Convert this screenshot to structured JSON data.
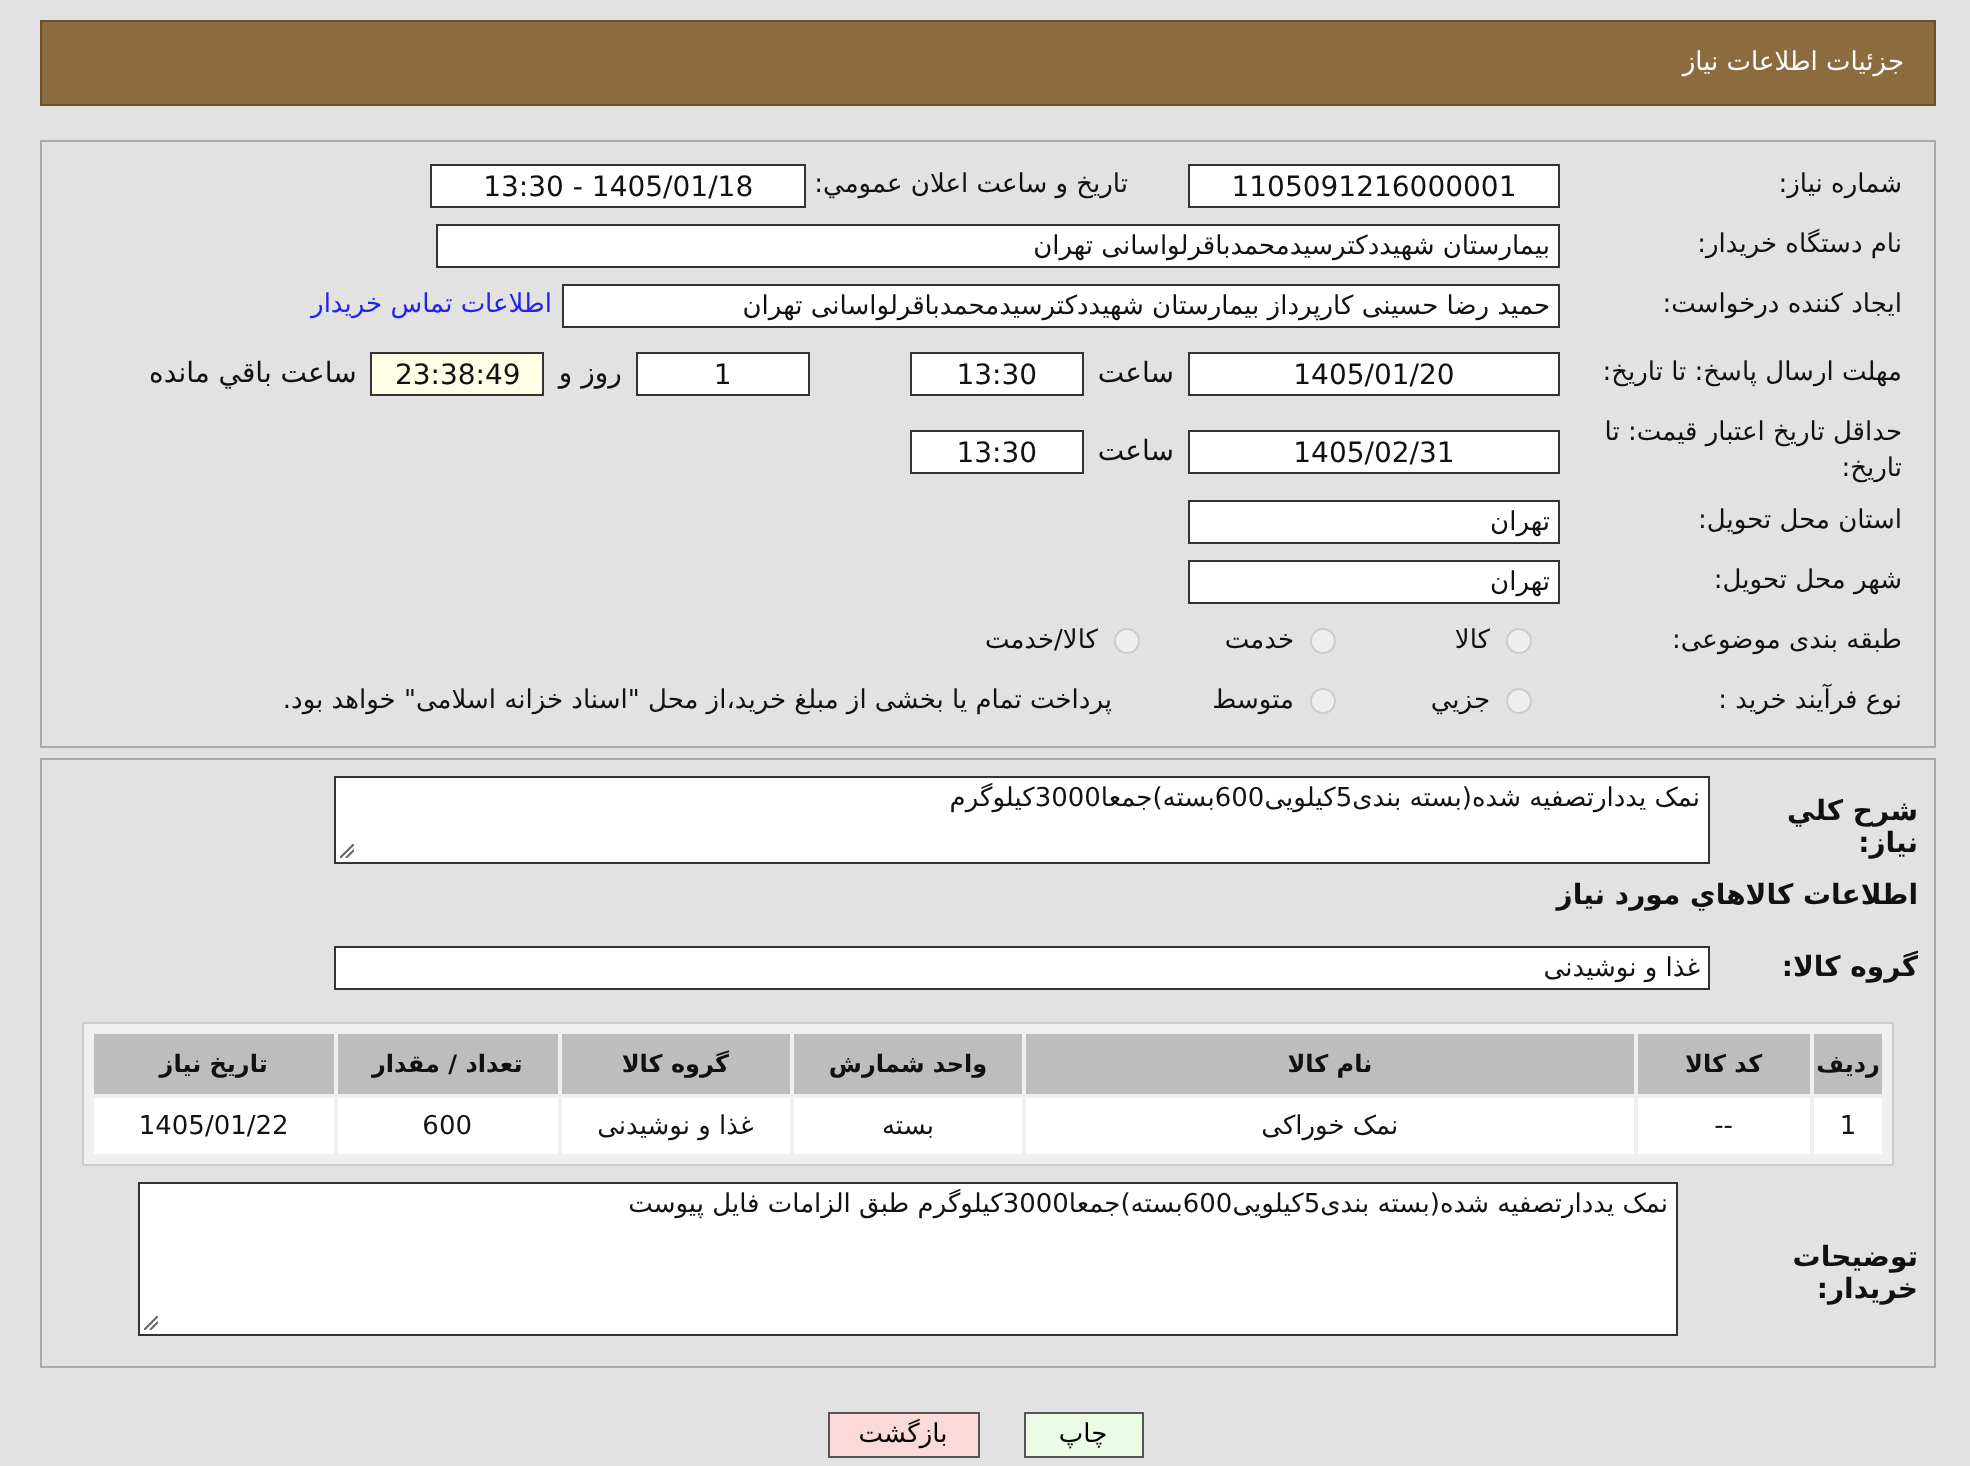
{
  "header": {
    "title": "جزئیات اطلاعات نیاز"
  },
  "need_number": {
    "label": "شماره نیاز:",
    "value": "1105091216000001"
  },
  "announce": {
    "label": "تاريخ و ساعت اعلان عمومي:",
    "value": "1405/01/18 - 13:30"
  },
  "buyer_org": {
    "label": "نام دستگاه خریدار:",
    "value": "بیمارستان شهیددکترسیدمحمدباقرلواسانی تهران"
  },
  "requester": {
    "label": "ایجاد کننده درخواست:",
    "value": "حمید رضا  حسینی کارپرداز بیمارستان شهیددکترسیدمحمدباقرلواسانی تهران",
    "link": "اطلاعات تماس خریدار"
  },
  "reply_deadline": {
    "label": "مهلت ارسال پاسخ: تا تاریخ:",
    "date": "1405/01/20",
    "time_label": "ساعت",
    "time": "13:30",
    "days": "1",
    "days_label": "روز و",
    "remaining": "23:38:49",
    "remaining_label": "ساعت باقي مانده"
  },
  "price_validity": {
    "label": "حداقل تاريخ اعتبار قيمت: تا تاريخ:",
    "date": "1405/02/31",
    "time_label": "ساعت",
    "time": "13:30"
  },
  "province": {
    "label": "استان محل تحویل:",
    "value": "تهران"
  },
  "city": {
    "label": "شهر محل تحویل:",
    "value": "تهران"
  },
  "category": {
    "label": "طبقه بندی موضوعی:",
    "options": [
      {
        "label": "کالا",
        "selected": false
      },
      {
        "label": "خدمت",
        "selected": false
      },
      {
        "label": "کالا/خدمت",
        "selected": false
      }
    ]
  },
  "process": {
    "label": "نوع فرآیند خرید :",
    "options": [
      {
        "label": "جزيي",
        "selected": false
      },
      {
        "label": "متوسط",
        "selected": false
      }
    ],
    "note": "پرداخت تمام یا بخشی از مبلغ خرید،از محل \"اسناد خزانه اسلامی\" خواهد بود."
  },
  "summary": {
    "label": "شرح كلي نياز:",
    "value": "نمک یددارتصفیه شده(بسته بندی5کیلویی600بسته)جمعا3000کیلوگرم"
  },
  "items_heading": "اطلاعات كالاهاي مورد نياز",
  "goods_group": {
    "label": "گروه کالا:",
    "value": "غذا و نوشیدنی"
  },
  "table": {
    "columns": [
      "رديف",
      "کد کالا",
      "نام کالا",
      "واحد شمارش",
      "گروه کالا",
      "تعداد / مقدار",
      "تاریخ نیاز"
    ],
    "rows": [
      [
        "1",
        "--",
        "نمک خوراکی",
        "بسته",
        "غذا و نوشیدنی",
        "600",
        "1405/01/22"
      ]
    ]
  },
  "buyer_notes": {
    "label": "توضیحات خریدار:",
    "value": "نمک یددارتصفیه شده(بسته بندی5کیلویی600بسته)جمعا3000کیلوگرم طبق الزامات فایل پیوست"
  },
  "buttons": [
    {
      "label": "چاپ",
      "kind": "print"
    },
    {
      "label": "بازگشت",
      "kind": "back"
    }
  ]
}
